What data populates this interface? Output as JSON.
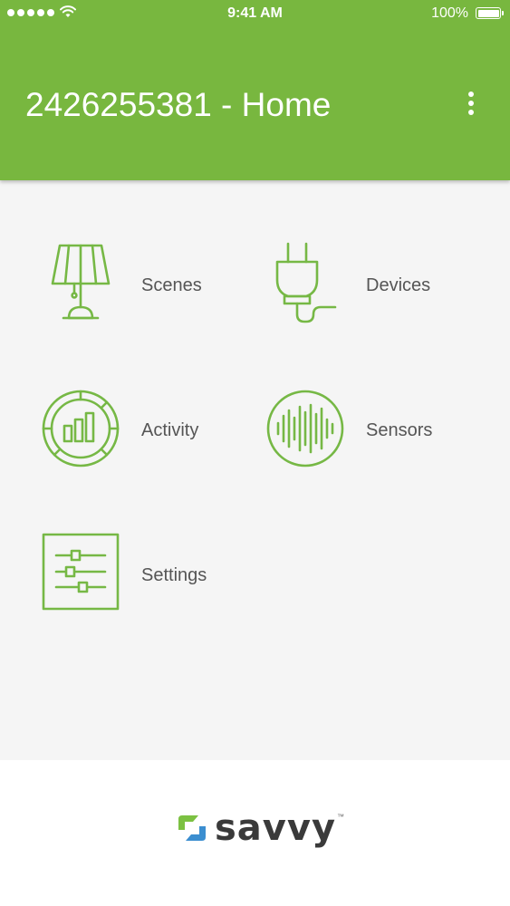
{
  "status_bar": {
    "time": "9:41 AM",
    "battery": "100%"
  },
  "header": {
    "title": "2426255381 - Home"
  },
  "tiles": [
    {
      "label": "Scenes",
      "icon": "lamp-icon"
    },
    {
      "label": "Devices",
      "icon": "plug-icon"
    },
    {
      "label": "Activity",
      "icon": "bar-chart-icon"
    },
    {
      "label": "Sensors",
      "icon": "sound-wave-icon"
    },
    {
      "label": "Settings",
      "icon": "sliders-icon"
    }
  ],
  "footer": {
    "logo_text": "savvy"
  },
  "colors": {
    "accent": "#78b73f",
    "icon": "#76b845",
    "label": "#555555",
    "background": "#f5f5f5"
  }
}
